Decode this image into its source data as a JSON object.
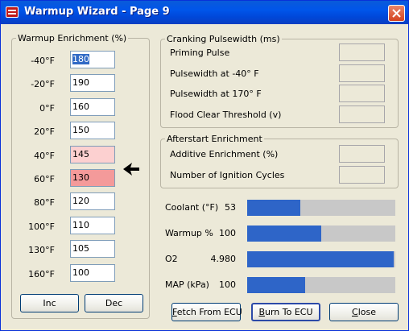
{
  "window": {
    "title": "Warmup Wizard - Page 9",
    "icon": "application-icon",
    "close_icon": "close-icon"
  },
  "warmup_enrichment": {
    "legend": "Warmup Enrichment (%)",
    "rows": [
      {
        "temp": "-40°F",
        "value": "180",
        "state": "selected"
      },
      {
        "temp": "-20°F",
        "value": "190",
        "state": "normal"
      },
      {
        "temp": "0°F",
        "value": "160",
        "state": "normal"
      },
      {
        "temp": "20°F",
        "value": "150",
        "state": "normal"
      },
      {
        "temp": "40°F",
        "value": "145",
        "state": "warm-light"
      },
      {
        "temp": "60°F",
        "value": "130",
        "state": "warm-active"
      },
      {
        "temp": "80°F",
        "value": "120",
        "state": "normal"
      },
      {
        "temp": "100°F",
        "value": "110",
        "state": "normal"
      },
      {
        "temp": "130°F",
        "value": "105",
        "state": "normal"
      },
      {
        "temp": "160°F",
        "value": "100",
        "state": "normal"
      }
    ],
    "pointer_icon": "left-arrow-pointer-icon",
    "inc_label": "Inc",
    "dec_label": "Dec"
  },
  "cranking": {
    "legend": "Cranking Pulsewidth (ms)",
    "items": [
      {
        "label": "Priming Pulse",
        "value": ""
      },
      {
        "label": "Pulsewidth at -40° F",
        "value": ""
      },
      {
        "label": "Pulsewidth at  170° F",
        "value": ""
      },
      {
        "label": "Flood Clear Threshold (v)",
        "value": ""
      }
    ]
  },
  "afterstart": {
    "legend": "Afterstart Enrichment",
    "items": [
      {
        "label": "Additive Enrichment (%)",
        "value": ""
      },
      {
        "label": "Number of Ignition Cycles",
        "value": ""
      }
    ]
  },
  "gauges": [
    {
      "label": "Coolant (°F)",
      "value": "53",
      "fraction": 0.36
    },
    {
      "label": "Warmup %",
      "value": "100",
      "fraction": 0.5
    },
    {
      "label": "O2",
      "value": "4.980",
      "fraction": 0.99
    },
    {
      "label": "MAP (kPa)",
      "value": "100",
      "fraction": 0.39
    }
  ],
  "footer": {
    "fetch": {
      "mnemonic": "F",
      "rest": "etch From ECU"
    },
    "burn": {
      "mnemonic": "B",
      "rest": "urn To ECU"
    },
    "close": {
      "mnemonic": "C",
      "rest": "lose"
    }
  },
  "colors": {
    "gauge_fill": "#2e65c8",
    "gauge_track": "#c8c8c8",
    "warm_light": "#fcd0d0",
    "warm_active": "#f49a9a",
    "selection": "#316ac5"
  }
}
